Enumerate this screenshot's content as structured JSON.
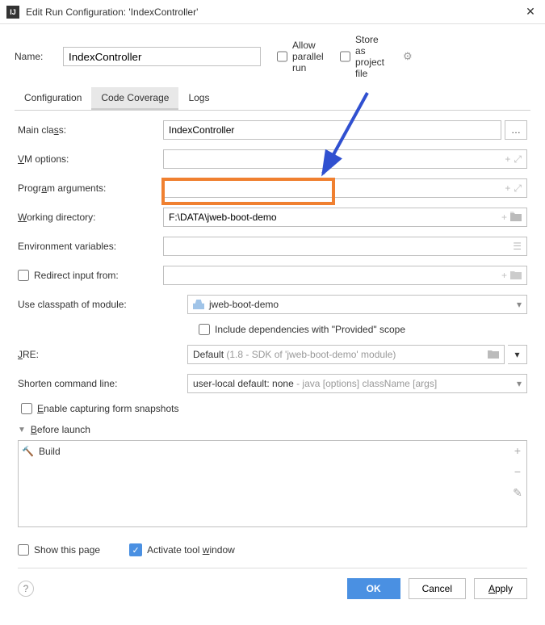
{
  "titlebar": {
    "title": "Edit Run Configuration: 'IndexController'"
  },
  "header": {
    "name_label": "Name:",
    "name_value": "IndexController",
    "allow_parallel": "Allow parallel run",
    "store_project": "Store as project file"
  },
  "tabs": {
    "config": "Configuration",
    "coverage": "Code Coverage",
    "logs": "Logs"
  },
  "form": {
    "main_class_label": "Main class:",
    "main_class_value": "IndexController",
    "vm_label": "VM options:",
    "vm_value": "",
    "args_label": "Program arguments:",
    "args_value": "",
    "workdir_label": "Working directory:",
    "workdir_value": "F:\\DATA\\jweb-boot-demo",
    "env_label": "Environment variables:",
    "env_value": "",
    "redirect_label": "Redirect input from:",
    "classpath_label": "Use classpath of module:",
    "classpath_value": "jweb-boot-demo",
    "include_provided": "Include dependencies with \"Provided\" scope",
    "jre_label": "JRE:",
    "jre_prefix": "Default",
    "jre_suffix": " (1.8 - SDK of 'jweb-boot-demo' module)",
    "shorten_label": "Shorten command line:",
    "shorten_prefix": "user-local default: none",
    "shorten_suffix": " - java [options] className [args]",
    "enable_snapshots": "Enable capturing form snapshots"
  },
  "before_launch": {
    "title": "Before launch",
    "build": "Build"
  },
  "footer": {
    "show_page": "Show this page",
    "activate": "Activate tool window",
    "ok": "OK",
    "cancel": "Cancel",
    "apply": "Apply"
  }
}
